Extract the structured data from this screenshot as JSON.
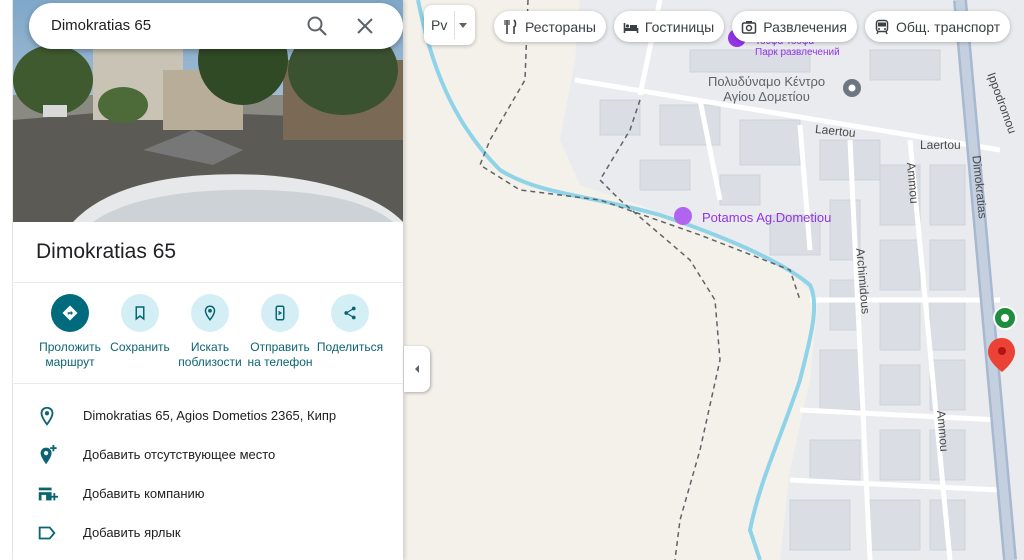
{
  "search": {
    "query": "Dimokratias 65"
  },
  "place": {
    "title": "Dimokratias 65"
  },
  "actions": [
    {
      "label": "Проложить маршрут",
      "icon": "directions-icon"
    },
    {
      "label": "Сохранить",
      "icon": "bookmark-icon"
    },
    {
      "label": "Искать поблизости",
      "icon": "nearby-icon"
    },
    {
      "label": "Отправить на телефон",
      "icon": "send-to-phone-icon"
    },
    {
      "label": "Поделиться",
      "icon": "share-icon"
    }
  ],
  "info": [
    {
      "text": "Dimokratias 65, Agios Dometios 2365, Кипр",
      "icon": "location-pin-icon"
    },
    {
      "text": "Добавить отсутствующее место",
      "icon": "add-place-icon"
    },
    {
      "text": "Добавить компанию",
      "icon": "add-business-icon"
    },
    {
      "text": "Добавить ярлык",
      "icon": "label-icon"
    }
  ],
  "map": {
    "layer_button": "Pv",
    "chips": [
      {
        "label": "Рестораны",
        "icon": "restaurant-icon"
      },
      {
        "label": "Гостиницы",
        "icon": "hotel-icon"
      },
      {
        "label": "Развлечения",
        "icon": "camera-icon"
      },
      {
        "label": "Общ. транспорт",
        "icon": "transit-icon"
      }
    ],
    "labels": {
      "park_line1": "Τούφα Τούφα",
      "park_line2": "Парк развлечений",
      "sport_center_line1": "Πολυδύναμο Κέντρο",
      "sport_center_line2": "Αγίου Δομετίου",
      "laertou_1": "Laertou",
      "laertou_2": "Laertou",
      "potamos": "Potamos Ag.Dometiou",
      "ammou_1": "Ammou",
      "ammou_2": "Ammou",
      "archimidous": "Archimidous",
      "dimokratias": "Dimokratias",
      "ippodromou": "Ippodromou"
    },
    "colors": {
      "river": "#8fd3e8",
      "poi_purple": "#9334e6",
      "pin_red": "#ea4335",
      "pin_green": "#1e8e3e",
      "road": "#ffffff",
      "main_road": "#a0b0c8"
    }
  }
}
